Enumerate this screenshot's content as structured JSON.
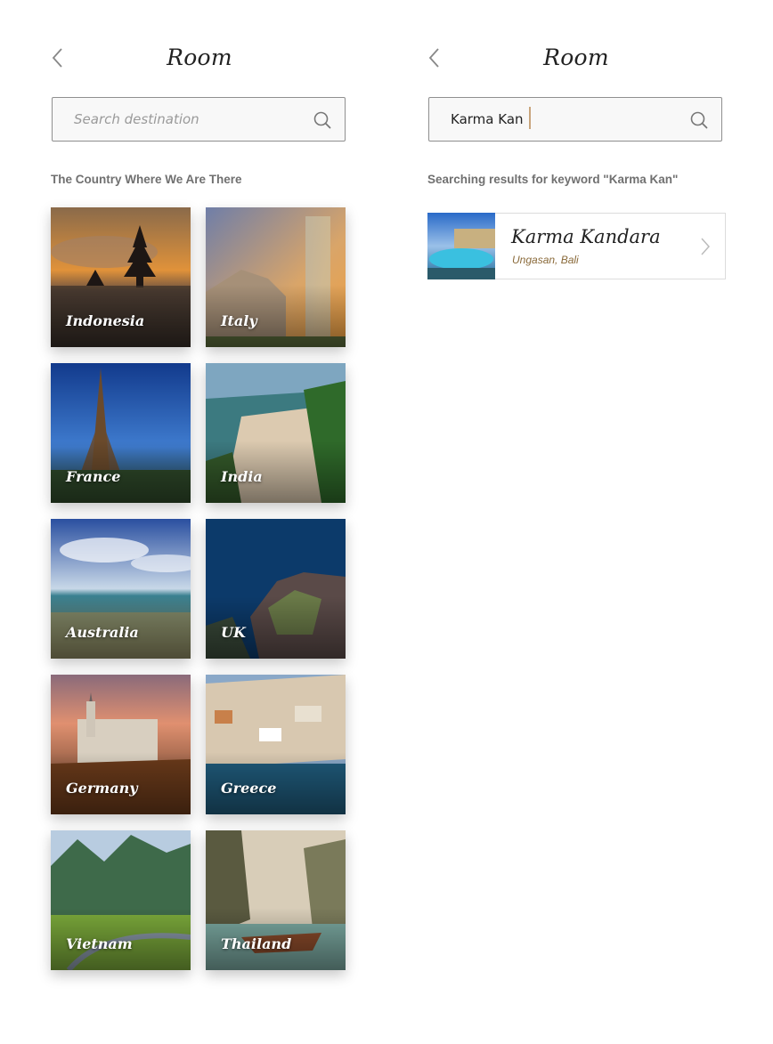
{
  "left_screen": {
    "title": "Room",
    "search": {
      "placeholder": "Search destination",
      "value": ""
    },
    "section_label": "The Country Where We Are There",
    "countries": [
      {
        "name": "Indonesia"
      },
      {
        "name": "Italy"
      },
      {
        "name": "France"
      },
      {
        "name": "India"
      },
      {
        "name": "Australia"
      },
      {
        "name": "UK"
      },
      {
        "name": "Germany"
      },
      {
        "name": "Greece"
      },
      {
        "name": "Vietnam"
      },
      {
        "name": "Thailand"
      }
    ]
  },
  "right_screen": {
    "title": "Room",
    "search": {
      "placeholder": "Search destination",
      "value": "Karma Kan"
    },
    "section_label": "Searching results for keyword \"Karma Kan\"",
    "results": [
      {
        "title": "Karma Kandara",
        "location": "Ungasan, Bali"
      }
    ]
  },
  "icons": [
    "back-chevron-icon",
    "search-icon",
    "chevron-right-icon"
  ],
  "colors": {
    "text_dark": "#222222",
    "label_gray": "#707070",
    "border": "#8f8f8f",
    "caret": "#c9a57c",
    "location": "#8a6a3a"
  }
}
